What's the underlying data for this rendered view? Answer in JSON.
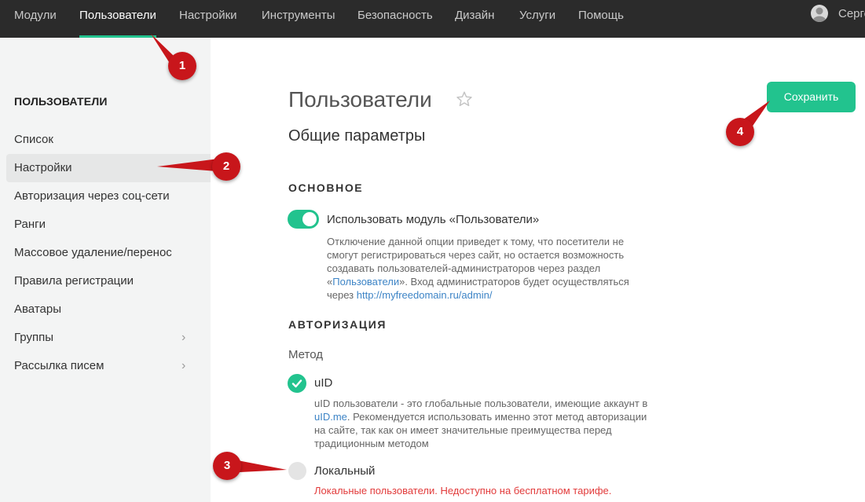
{
  "nav": {
    "items": [
      {
        "label": "Модули"
      },
      {
        "label": "Пользователи"
      },
      {
        "label": "Настройки"
      },
      {
        "label": "Инструменты"
      },
      {
        "label": "Безопасность"
      },
      {
        "label": "Дизайн"
      },
      {
        "label": "Услуги"
      },
      {
        "label": "Помощь"
      }
    ],
    "active_index": 1,
    "user_name": "Серге"
  },
  "sidebar": {
    "title": "ПОЛЬЗОВАТЕЛИ",
    "items": [
      {
        "label": "Список"
      },
      {
        "label": "Настройки"
      },
      {
        "label": "Авторизация через соц-сети"
      },
      {
        "label": "Ранги"
      },
      {
        "label": "Массовое удаление/перенос"
      },
      {
        "label": "Правила регистрации"
      },
      {
        "label": "Аватары"
      },
      {
        "label": "Группы",
        "chevron": "›"
      },
      {
        "label": "Рассылка писем",
        "chevron": "›"
      }
    ],
    "active_index": 1
  },
  "page": {
    "title": "Пользователи",
    "subtitle": "Общие параметры",
    "save_label": "Сохранить"
  },
  "basic": {
    "section_title": "ОСНОВНОЕ",
    "toggle_label": "Использовать модуль «Пользователи»",
    "toggle_on": true,
    "desc_part1": "Отключение данной опции приведет к тому, что посетители не смогут регистрироваться через сайт, но остается возможность создавать пользователей-администраторов через раздел «",
    "desc_link": "Пользователи",
    "desc_part2": "». Вход администраторов будет осуществляться через ",
    "desc_url": "http://myfreedomain.ru/admin/"
  },
  "auth": {
    "section_title": "АВТОРИЗАЦИЯ",
    "method_label": "Метод",
    "options": [
      {
        "label": "uID",
        "selected": true,
        "desc_part1": "uID пользователи - это глобальные пользователи, имеющие аккаунт в ",
        "desc_link": "uID.me",
        "desc_part2": ". Рекомендуется использовать именно этот метод авторизации на сайте, так как он имеет значительные преимущества перед традиционным методом"
      },
      {
        "label": "Локальный",
        "selected": false,
        "warning": "Локальные пользователи. Недоступно на бесплатном тарифе."
      }
    ]
  },
  "annotations": [
    "1",
    "2",
    "3",
    "4"
  ],
  "colors": {
    "accent": "#22c38e",
    "nav_bg": "#2b2b2b",
    "sidebar_bg": "#f3f4f4",
    "marker": "#c8161b",
    "link": "#3d84c6",
    "warning": "#e23b3b"
  }
}
